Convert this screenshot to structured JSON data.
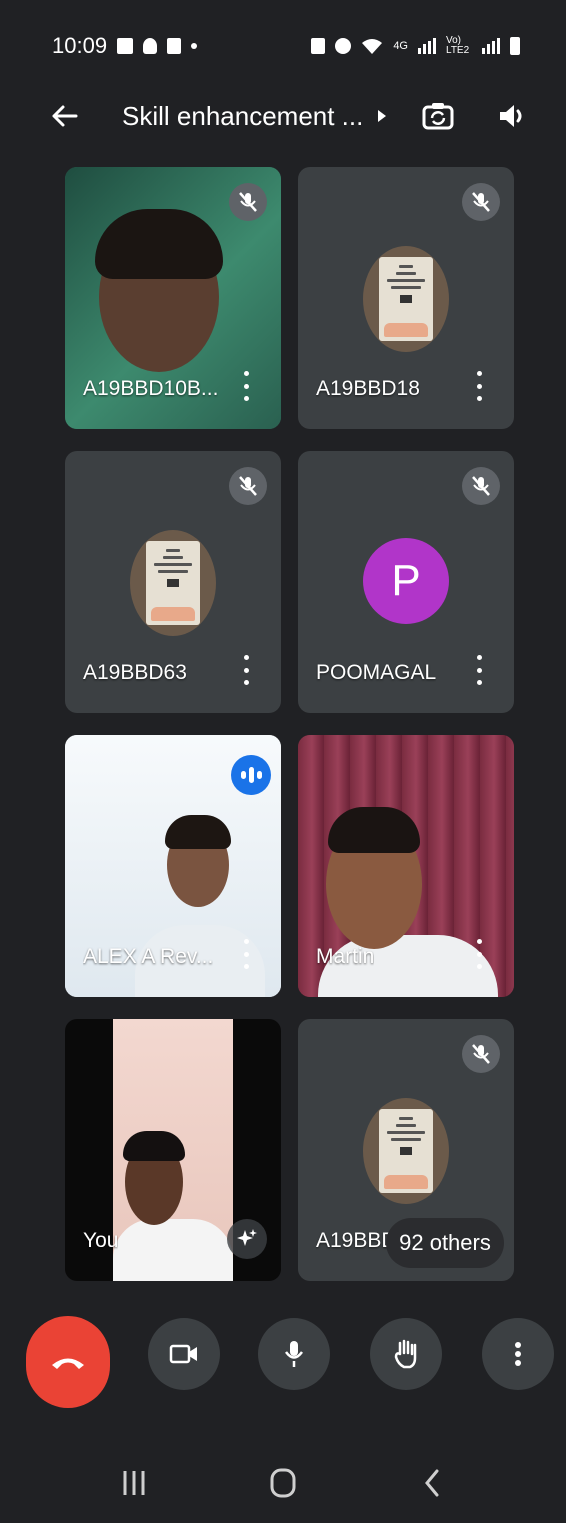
{
  "status_bar": {
    "time": "10:09",
    "network_label": "4G",
    "volte_label": "Vo) LTE2"
  },
  "header": {
    "title": "Skill enhancement ...",
    "icons": [
      "back-arrow-icon",
      "chevron-right-icon",
      "switch-camera-icon",
      "speaker-icon"
    ]
  },
  "participants": [
    {
      "name": "A19BBD10B...",
      "type": "video",
      "muted": true
    },
    {
      "name": "A19BBD18",
      "type": "poster-avatar",
      "muted": true
    },
    {
      "name": "A19BBD63",
      "type": "poster-avatar",
      "muted": true
    },
    {
      "name": "POOMAGAL",
      "type": "letter-avatar",
      "initial": "P",
      "avatar_color": "#b135c9",
      "muted": true
    },
    {
      "name": "ALEX A Rev...",
      "type": "video",
      "speaking": true
    },
    {
      "name": "Martin",
      "type": "video"
    },
    {
      "name": "You",
      "type": "video-self",
      "effects_icon": "sparkle-icon"
    },
    {
      "name": "A19BBD",
      "type": "poster-avatar",
      "muted": true
    }
  ],
  "poster_text": [
    "Hst",
    "BBM",
    "UNITY IS OUR",
    "DIGNITY"
  ],
  "others_label": "92 others",
  "controls": [
    "end-call",
    "camera",
    "microphone",
    "raise-hand",
    "more-options"
  ],
  "colors": {
    "background": "#202124",
    "tile": "#3c4043",
    "end_call": "#ea4335",
    "speaking": "#1a73e8"
  }
}
